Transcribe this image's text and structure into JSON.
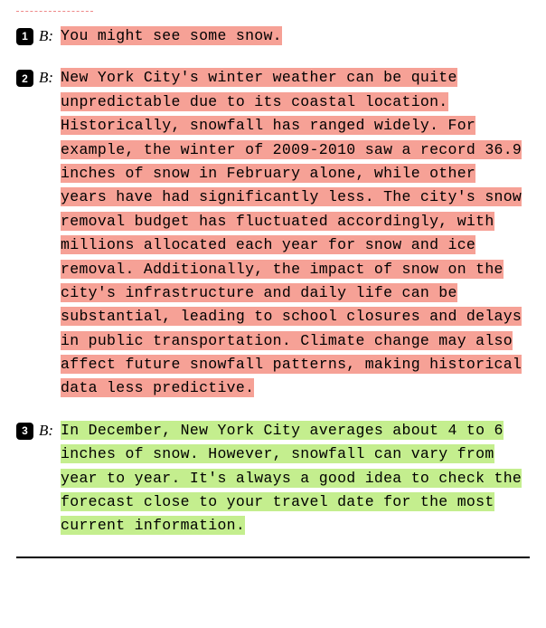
{
  "items": [
    {
      "num": "1",
      "speaker": "B:",
      "highlight": "red",
      "text": "You might see some snow."
    },
    {
      "num": "2",
      "speaker": "B:",
      "highlight": "red",
      "text": "New York City's winter weather can be quite unpredictable due to its coastal location. Historically, snowfall has ranged widely. For example, the winter of 2009-2010 saw a record 36.9 inches of snow in February alone, while other years have had significantly less. The city's snow removal budget has fluctuated accordingly, with millions allocated each year for snow and ice removal. Additionally, the impact of snow on the city's infrastructure and daily life can be substantial, leading to school closures and delays in public transportation. Climate change may also affect future snowfall patterns, making historical data less predictive."
    },
    {
      "num": "3",
      "speaker": "B:",
      "highlight": "green",
      "text": "In December, New York City averages about 4 to 6 inches of snow. However, snowfall can vary from year to year. It's always a good idea to check the forecast close to your travel date for the most current information."
    }
  ]
}
